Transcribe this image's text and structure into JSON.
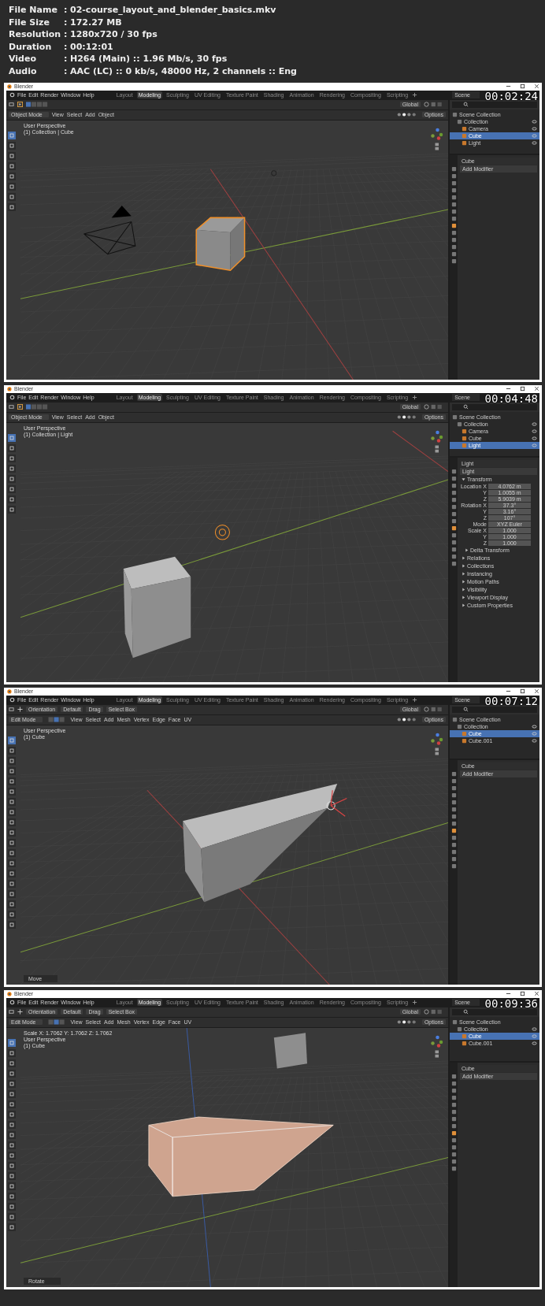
{
  "info": [
    {
      "label": "File Name",
      "separator": ":",
      "value": "02-course_layout_and_blender_basics.mkv"
    },
    {
      "label": "File Size",
      "separator": ":",
      "value": "172.27 MB"
    },
    {
      "label": "Resolution",
      "separator": ":",
      "value": "1280x720 / 30 fps"
    },
    {
      "label": "Duration",
      "separator": ":",
      "value": "00:12:01"
    },
    {
      "label": "Video",
      "separator": ":",
      "value": "H264 (Main) :: 1.96 Mb/s, 30 fps"
    },
    {
      "label": "Audio",
      "separator": ":",
      "value": "AAC (LC) :: 0 kb/s, 48000 Hz, 2 channels :: Eng"
    }
  ],
  "frames": [
    {
      "timestamp": "00:02:24",
      "window_title": "Blender",
      "menu": [
        "File",
        "Edit",
        "Render",
        "Window",
        "Help"
      ],
      "workspace_tabs": [
        {
          "label": "Layout",
          "selected": false
        },
        {
          "label": "Modeling",
          "selected": true
        },
        {
          "label": "Sculpting",
          "selected": false
        },
        {
          "label": "UV Editing",
          "selected": false
        },
        {
          "label": "Texture Paint",
          "selected": false
        },
        {
          "label": "Shading",
          "selected": false
        },
        {
          "label": "Animation",
          "selected": false
        },
        {
          "label": "Rendering",
          "selected": false
        },
        {
          "label": "Compositing",
          "selected": false
        },
        {
          "label": "Scripting",
          "selected": false
        }
      ],
      "scene_field": "Scene",
      "mode": {
        "kind": "object",
        "label": "Object Mode"
      },
      "transform_orientation": "Global",
      "viewport_menu": [
        "View",
        "Select",
        "Add",
        "Object"
      ],
      "options": "Options",
      "overlay": [
        "User Perspective",
        "(1) Collection | Cube"
      ],
      "viewport": {
        "kind": "cube_camera"
      },
      "outliner": [
        {
          "label": "Scene Collection",
          "selected": false,
          "children": [
            {
              "label": "Collection",
              "selected": false,
              "children": [
                {
                  "label": "Camera",
                  "selected": false
                },
                {
                  "label": "Cube",
                  "selected": true
                },
                {
                  "label": "Light",
                  "selected": false
                }
              ]
            }
          ]
        }
      ],
      "properties": {
        "kind": "modifiers",
        "object_name": "Cube",
        "button": "Add Modifier"
      }
    },
    {
      "timestamp": "00:04:48",
      "window_title": "Blender",
      "menu": [
        "File",
        "Edit",
        "Render",
        "Window",
        "Help"
      ],
      "workspace_tabs": [
        {
          "label": "Layout",
          "selected": false
        },
        {
          "label": "Modeling",
          "selected": true
        },
        {
          "label": "Sculpting",
          "selected": false
        },
        {
          "label": "UV Editing",
          "selected": false
        },
        {
          "label": "Texture Paint",
          "selected": false
        },
        {
          "label": "Shading",
          "selected": false
        },
        {
          "label": "Animation",
          "selected": false
        },
        {
          "label": "Rendering",
          "selected": false
        },
        {
          "label": "Compositing",
          "selected": false
        },
        {
          "label": "Scripting",
          "selected": false
        }
      ],
      "scene_field": "Scene",
      "mode": {
        "kind": "object",
        "label": "Object Mode"
      },
      "transform_orientation": "Global",
      "viewport_menu": [
        "View",
        "Select",
        "Add",
        "Object"
      ],
      "options": "Options",
      "overlay": [
        "User Perspective",
        "(1) Collection | Light"
      ],
      "viewport": {
        "kind": "cube_light"
      },
      "outliner": [
        {
          "label": "Scene Collection",
          "selected": false,
          "children": [
            {
              "label": "Collection",
              "selected": false,
              "children": [
                {
                  "label": "Camera",
                  "selected": false
                },
                {
                  "label": "Cube",
                  "selected": false
                },
                {
                  "label": "Light",
                  "selected": true
                }
              ]
            }
          ]
        }
      ],
      "properties": {
        "kind": "object",
        "object_name": "Light",
        "name_field": "Light",
        "section": "Transform",
        "rows": [
          {
            "label": "Location X",
            "value": "4.0762 m"
          },
          {
            "label": "Y",
            "value": "1.0055 m"
          },
          {
            "label": "Z",
            "value": "5.9039 m"
          },
          {
            "label": "Rotation X",
            "value": "37.3°"
          },
          {
            "label": "Y",
            "value": "3.16°"
          },
          {
            "label": "Z",
            "value": "107°"
          },
          {
            "label": "Mode",
            "value": "XYZ Euler"
          },
          {
            "label": "Scale X",
            "value": "1.000"
          },
          {
            "label": "Y",
            "value": "1.000"
          },
          {
            "label": "Z",
            "value": "1.000"
          }
        ],
        "subsection": "Delta Transform",
        "panels": [
          "Relations",
          "Collections",
          "Instancing",
          "Motion Paths",
          "Visibility",
          "Viewport Display",
          "Custom Properties"
        ]
      }
    },
    {
      "timestamp": "00:07:12",
      "window_title": "Blender",
      "menu": [
        "File",
        "Edit",
        "Render",
        "Window",
        "Help"
      ],
      "workspace_tabs": [
        {
          "label": "Layout",
          "selected": false
        },
        {
          "label": "Modeling",
          "selected": true
        },
        {
          "label": "Sculpting",
          "selected": false
        },
        {
          "label": "UV Editing",
          "selected": false
        },
        {
          "label": "Texture Paint",
          "selected": false
        },
        {
          "label": "Shading",
          "selected": false
        },
        {
          "label": "Animation",
          "selected": false
        },
        {
          "label": "Rendering",
          "selected": false
        },
        {
          "label": "Compositing",
          "selected": false
        },
        {
          "label": "Scripting",
          "selected": false
        }
      ],
      "scene_field": "Scene",
      "mode": {
        "kind": "edit",
        "label": "Edit Mode"
      },
      "tool_header": [
        "Orientation",
        "Default",
        "Drag",
        "Select Box"
      ],
      "transform_orientation": "Global",
      "viewport_menu": [
        "View",
        "Select",
        "Add",
        "Mesh",
        "Vertex",
        "Edge",
        "Face",
        "UV"
      ],
      "options": "Options",
      "overlay": [
        "User Perspective",
        "(1) Cube"
      ],
      "viewport": {
        "kind": "extruded"
      },
      "operator_panel": "Move",
      "outliner": [
        {
          "label": "Scene Collection",
          "selected": false,
          "children": [
            {
              "label": "Collection",
              "selected": false,
              "children": [
                {
                  "label": "Cube",
                  "selected": true
                },
                {
                  "label": "Cube.001",
                  "selected": false
                }
              ]
            }
          ]
        }
      ],
      "properties": {
        "kind": "modifiers",
        "object_name": "Cube",
        "button": "Add Modifier"
      }
    },
    {
      "timestamp": "00:09:36",
      "window_title": "Blender",
      "menu": [
        "File",
        "Edit",
        "Render",
        "Window",
        "Help"
      ],
      "workspace_tabs": [
        {
          "label": "Layout",
          "selected": false
        },
        {
          "label": "Modeling",
          "selected": true
        },
        {
          "label": "Sculpting",
          "selected": false
        },
        {
          "label": "UV Editing",
          "selected": false
        },
        {
          "label": "Texture Paint",
          "selected": false
        },
        {
          "label": "Shading",
          "selected": false
        },
        {
          "label": "Animation",
          "selected": false
        },
        {
          "label": "Rendering",
          "selected": false
        },
        {
          "label": "Compositing",
          "selected": false
        },
        {
          "label": "Scripting",
          "selected": false
        }
      ],
      "scene_field": "Scene",
      "mode": {
        "kind": "edit",
        "label": "Edit Mode"
      },
      "tool_header": [
        "Orientation",
        "Default",
        "Drag",
        "Select Box"
      ],
      "transform_orientation": "Global",
      "viewport_menu": [
        "View",
        "Select",
        "Add",
        "Mesh",
        "Vertex",
        "Edge",
        "Face",
        "UV"
      ],
      "options": "Options",
      "status_text": "Scale X: 1.7062  Y: 1.7062  Z: 1.7062",
      "overlay": [
        "User Perspective",
        "(1) Cube"
      ],
      "viewport": {
        "kind": "extruded_scaled"
      },
      "operator_panel": "Rotate",
      "outliner": [
        {
          "label": "Scene Collection",
          "selected": false,
          "children": [
            {
              "label": "Collection",
              "selected": false,
              "children": [
                {
                  "label": "Cube",
                  "selected": true
                },
                {
                  "label": "Cube.001",
                  "selected": false
                }
              ]
            }
          ]
        }
      ],
      "properties": {
        "kind": "modifiers",
        "object_name": "Cube",
        "button": "Add Modifier"
      }
    }
  ]
}
